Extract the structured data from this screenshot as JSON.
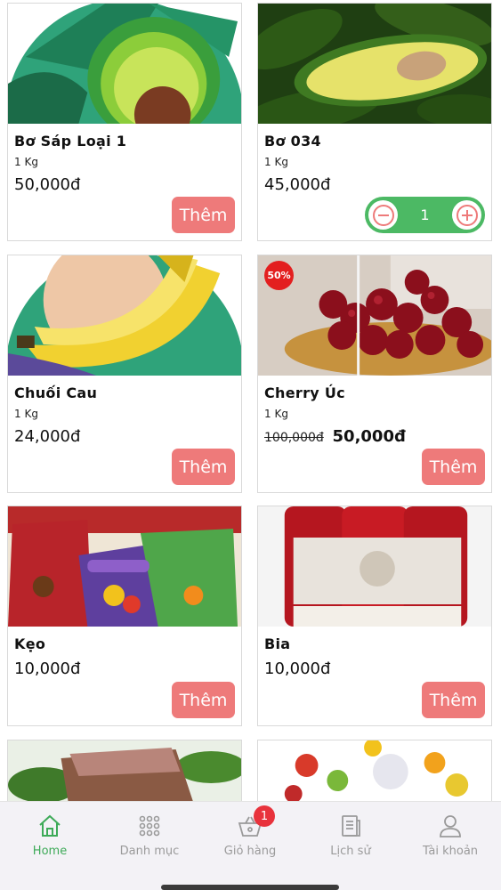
{
  "currency_suffix": "đ",
  "products": [
    {
      "name": "Bơ Sáp Loại 1",
      "unit": "1 Kg",
      "price": "50,000đ",
      "button": "Thêm"
    },
    {
      "name": "Bơ 034",
      "unit": "1 Kg",
      "price": "45,000đ",
      "quantity": "1"
    },
    {
      "name": "Chuối Cau",
      "unit": "1 Kg",
      "price": "24,000đ",
      "button": "Thêm"
    },
    {
      "name": "Cherry Úc",
      "unit": "1 Kg",
      "old_price": "100,000đ",
      "price": "50,000đ",
      "discount": "50%",
      "button": "Thêm"
    },
    {
      "name": "Kẹo",
      "price": "10,000đ",
      "button": "Thêm"
    },
    {
      "name": "Bia",
      "price": "10,000đ",
      "button": "Thêm"
    }
  ],
  "tabbar": {
    "items": [
      {
        "label": "Home",
        "icon": "home-icon",
        "active": true
      },
      {
        "label": "Danh mục",
        "icon": "grid-icon"
      },
      {
        "label": "Giỏ hàng",
        "icon": "basket-icon",
        "badge": "1"
      },
      {
        "label": "Lịch sử",
        "icon": "history-icon"
      },
      {
        "label": "Tài khoản",
        "icon": "user-icon"
      }
    ]
  },
  "colors": {
    "accent": "#4cb964",
    "add_button": "#ee7a7a",
    "badge": "#e31f1f",
    "tab_active": "#3daa58"
  }
}
